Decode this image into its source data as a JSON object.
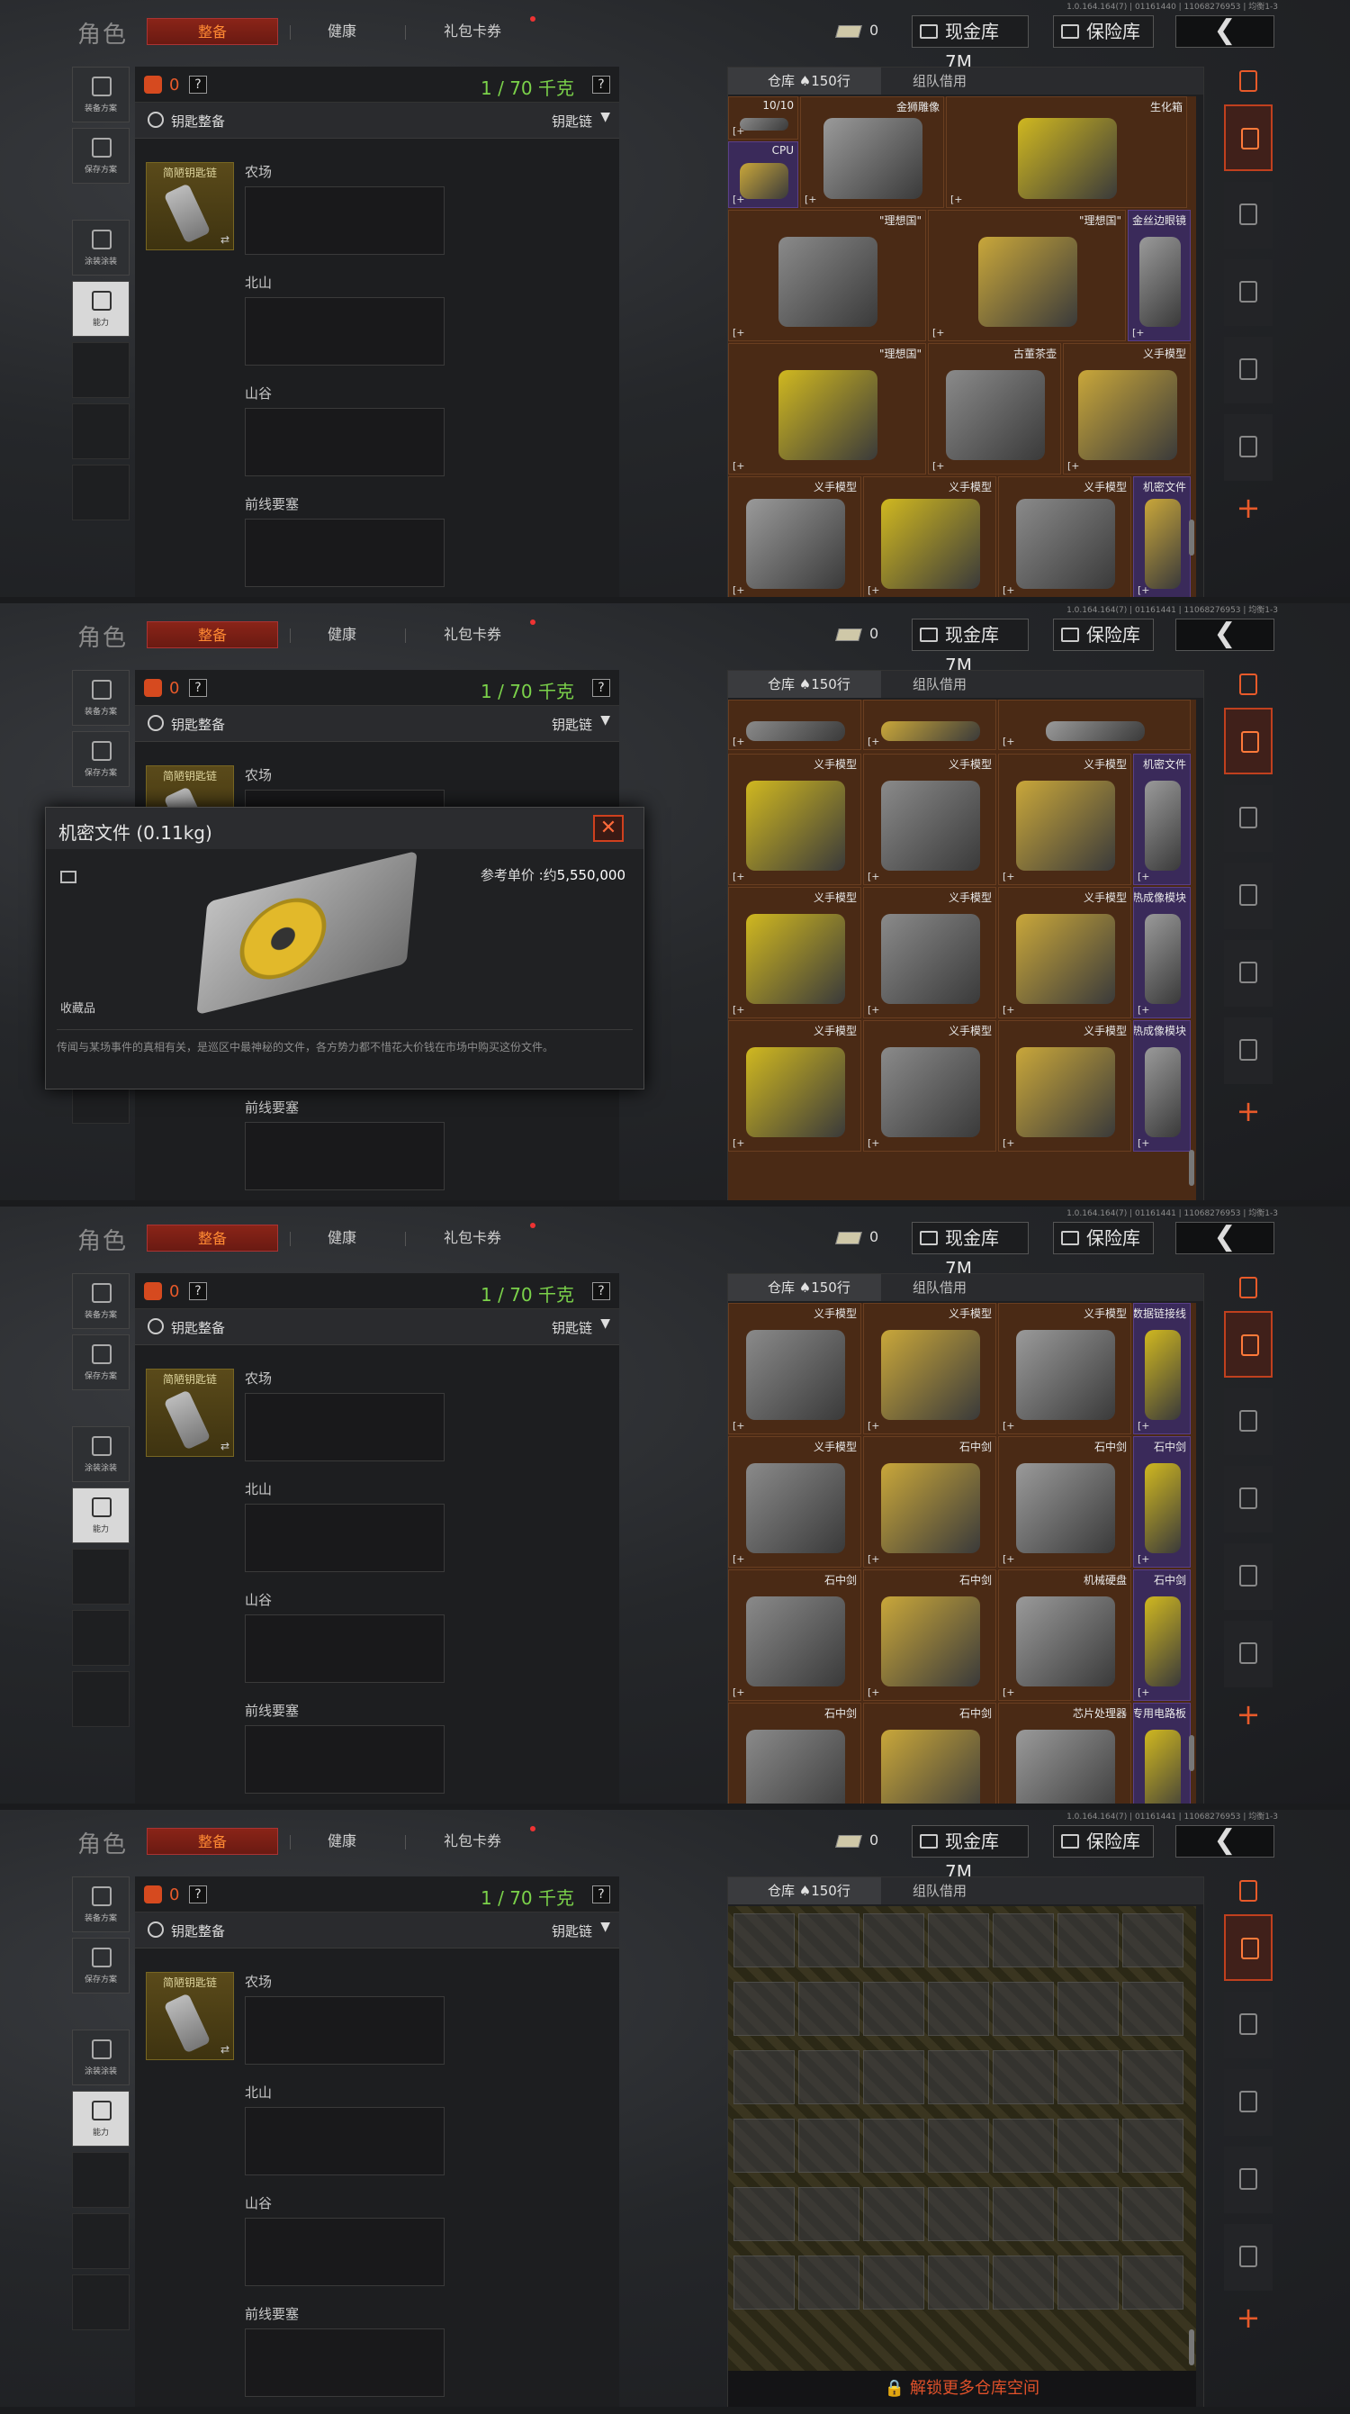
{
  "header": {
    "title": "角色",
    "tabs": [
      "整备",
      "健康",
      "礼包卡券"
    ],
    "cash_amount": "0",
    "cash_vault": "现金库 7M",
    "safe_vault": "保险库",
    "back": "❮"
  },
  "versions": [
    "1.0.164.164(7) | 01161440 | 11068276953 | 均衡1-3",
    "1.0.164.164(7) | 01161441 | 11068276953 | 均衡1-3",
    "1.0.164.164(7) | 01161441 | 11068276953 | 均衡1-3",
    "1.0.164.164(7) | 01161441 | 11068276953 | 均衡1-3"
  ],
  "leftnav": {
    "loadout_plan": "装备方案",
    "save_plan": "保存方案",
    "skin_plan": "涂装涂装",
    "ability": "能力"
  },
  "loadout": {
    "weight_zero": "0",
    "weight": "1 / 70 千克",
    "q": "?",
    "key_label": "钥匙整备",
    "key_select": "钥匙链",
    "keycard_name": "简陋钥匙链",
    "zones": [
      "农场",
      "北山",
      "山谷",
      "前线要塞"
    ]
  },
  "stash": {
    "tab_label": "仓库 ♠150行",
    "team_label": "组队借用",
    "unlock": "🔒 解锁更多仓库空间"
  },
  "items": {
    "p1": [
      "10/10",
      "CPU",
      "金狮雕像",
      "生化箱",
      "\"理想国\"",
      "\"理想国\"",
      "金丝边眼镜",
      "\"理想国\"",
      "古董茶壶",
      "义手模型",
      "义手模型",
      "义手模型",
      "义手模型",
      "机密文件"
    ],
    "p2": [
      "义手模型",
      "义手模型",
      "义手模型",
      "机密文件",
      "义手模型",
      "义手模型",
      "义手模型",
      "热成像模块",
      "义手模型",
      "义手模型",
      "义手模型",
      "热成像模块"
    ],
    "p3": [
      "义手模型",
      "义手模型",
      "义手模型",
      "数据链接线",
      "义手模型",
      "石中剑",
      "石中剑",
      "石中剑",
      "石中剑",
      "石中剑",
      "机械硬盘",
      "石中剑",
      "石中剑",
      "石中剑",
      "芯片处理器",
      "专用电路板"
    ]
  },
  "popup": {
    "title": "机密文件 (0.11kg)",
    "close": "✕",
    "price_label": "参考单价 :约",
    "price_value": "5,550,000",
    "favorite": "收藏品",
    "description": "传闻与某场事件的真相有关，是巡区中最神秘的文件，各方势力都不惜花大价钱在市场中购买这份文件。"
  },
  "colors": {
    "accent": "#e85a2a",
    "weight_green": "#7bd24a",
    "stash_brown": "#4a2a15",
    "rare_purple": "#3a2a5a"
  }
}
